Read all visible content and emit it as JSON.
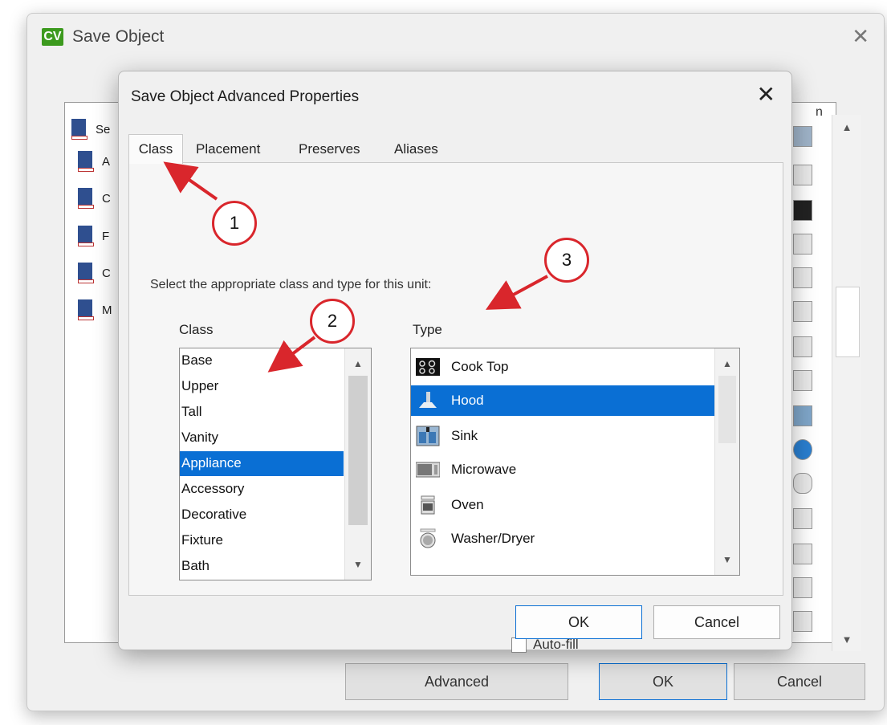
{
  "outer_window": {
    "title": "Save Object",
    "logo_text": "CV",
    "list_header_fragment": "Se",
    "column_header_fragment": "n",
    "list_row_initials": [
      "A",
      "C",
      "F",
      "C",
      "M"
    ],
    "buttons": {
      "advanced": "Advanced",
      "ok": "OK",
      "cancel": "Cancel"
    }
  },
  "dialog": {
    "title": "Save Object Advanced Properties",
    "tabs": [
      "Class",
      "Placement",
      "Preserves",
      "Aliases"
    ],
    "active_tab": "Class",
    "instruction": "Select the appropriate class and type for this unit:",
    "class_label": "Class",
    "type_label": "Type",
    "class_items": [
      "Base",
      "Upper",
      "Tall",
      "Vanity",
      "Appliance",
      "Accessory",
      "Decorative",
      "Fixture",
      "Bath"
    ],
    "selected_class": "Appliance",
    "type_items": [
      {
        "label": "Cook Top",
        "icon": "cooktop-icon"
      },
      {
        "label": "Hood",
        "icon": "hood-icon"
      },
      {
        "label": "Sink",
        "icon": "sink-icon"
      },
      {
        "label": "Microwave",
        "icon": "microwave-icon"
      },
      {
        "label": "Oven",
        "icon": "oven-icon"
      },
      {
        "label": "Washer/Dryer",
        "icon": "washer-dryer-icon"
      }
    ],
    "selected_type": "Hood",
    "autofill_label": "Auto-fill",
    "autofill_checked": false,
    "ok_label": "OK",
    "cancel_label": "Cancel"
  },
  "annotations": [
    "1",
    "2",
    "3"
  ],
  "colors": {
    "selection": "#0a6fd4",
    "annotation_red": "#d9262c",
    "logo_green": "#3c9a1e"
  }
}
